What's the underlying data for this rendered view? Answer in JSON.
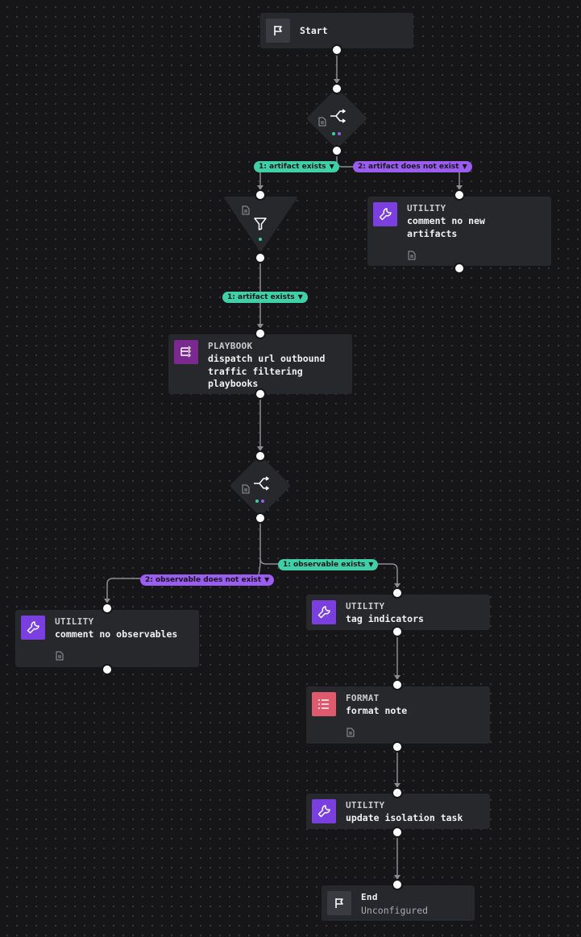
{
  "colors": {
    "background": "#161618",
    "node": "#27282c",
    "utility": "#7b3fe0",
    "playbook": "#7a2a8e",
    "format": "#e05a6e",
    "green_label": "#3fd0a8",
    "purple_label": "#9b5cf0",
    "edge": "#8c8c92"
  },
  "nodes": {
    "start": {
      "title": "Start",
      "icon": "flag-icon"
    },
    "comment_no_new_artifacts": {
      "type": "UTILITY",
      "title": "comment no new artifacts",
      "icon": "wrench-icon"
    },
    "dispatch_playbooks": {
      "type": "PLAYBOOK",
      "title": "dispatch url outbound traffic filtering playbooks",
      "icon": "playbook-icon"
    },
    "comment_no_observables": {
      "type": "UTILITY",
      "title": "comment no observables",
      "icon": "wrench-icon"
    },
    "tag_indicators": {
      "type": "UTILITY",
      "title": "tag indicators",
      "icon": "wrench-icon"
    },
    "format_note": {
      "type": "FORMAT",
      "title": "format note",
      "icon": "list-icon"
    },
    "update_isolation_task": {
      "type": "UTILITY",
      "title": "update isolation task",
      "icon": "wrench-icon"
    },
    "end": {
      "title": "End",
      "subtitle": "Unconfigured",
      "icon": "flag-icon"
    }
  },
  "labels": {
    "artifact_exists_1": "1: artifact exists",
    "artifact_does_not_exist": "2: artifact does not exist",
    "artifact_exists_filter": "1: artifact exists",
    "observable_exists": "1: observable exists",
    "observable_does_not_exist": "2: observable does not exist"
  }
}
